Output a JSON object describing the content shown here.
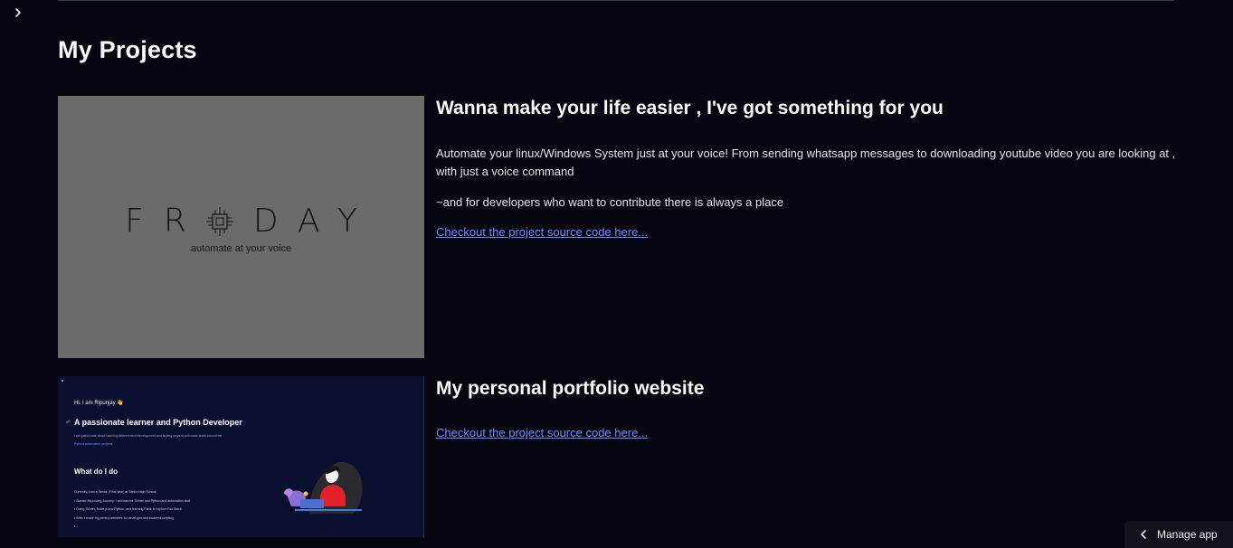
{
  "page": {
    "title": "My Projects"
  },
  "sidebar_toggle": {
    "icon": "chevron-right-icon"
  },
  "projects": [
    {
      "heading": "Wanna make your life easier , I've got something for you",
      "paragraphs": [
        "Automate your linux/Windows System just at your voice! From sending whatsapp messages to downloading youtube video you are looking at , with just a voice command",
        "~and for developers who want to contribute there is always a place"
      ],
      "link_text": "Checkout the project source code here...",
      "image": {
        "logo_text_left": "FR",
        "logo_text_right": "DAY",
        "tagline": "automate at your voice"
      }
    },
    {
      "heading": "My personal portfolio website",
      "link_text": "Checkout the project source code here...",
      "image": {
        "greeting": "Hi, I am Ripunjay 👋",
        "title": "A passionate learner and Python Developer",
        "subtitle": "I am passionate about learning different tech/development and finding ways to automate stuffs around me",
        "link": "Python automation projects",
        "section": "What do I do",
        "intro": "Currently, I am a Senior (Final year) at Senior High School",
        "list": [
          "Started My coding Journey: I am learned Tkinter and Python and automation stuff",
          "Doing Tkinter, Node.js and Python, and learning Flask to explore Full Stack",
          "Web: I make my perfect websites for developer and backend scripting",
          "..."
        ]
      }
    }
  ],
  "manage_app": {
    "label": "Manage app",
    "icon": "chevron-left-icon"
  },
  "colors": {
    "background": "#050510",
    "link": "#6e8cff",
    "friday_image_bg": "#6b6b6b",
    "portfolio_image_bg": "#0b1030"
  }
}
